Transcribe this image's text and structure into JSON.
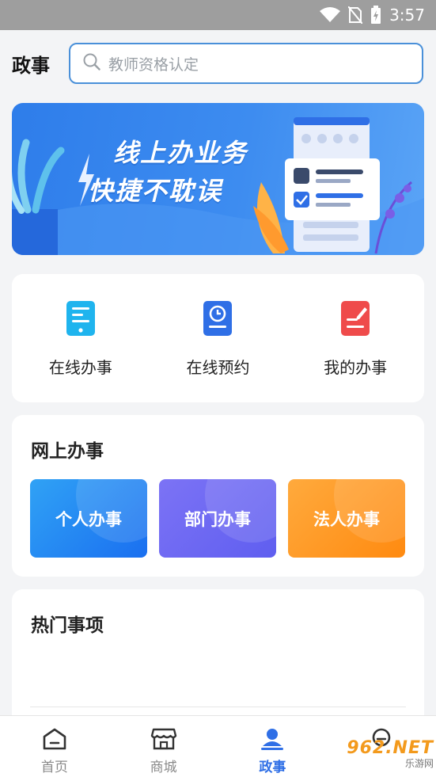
{
  "status_bar": {
    "time": "3:57"
  },
  "header": {
    "title": "政事",
    "search_placeholder": "教师资格认定"
  },
  "banner": {
    "line1": "线上办业务",
    "line2": "快捷不耽误"
  },
  "quick_services": [
    {
      "label": "在线办事",
      "icon": "phone-doc-icon",
      "color": "#1fb4ee"
    },
    {
      "label": "在线预约",
      "icon": "clock-doc-icon",
      "color": "#2f6fe6"
    },
    {
      "label": "我的办事",
      "icon": "edit-doc-icon",
      "color": "#ef4b4b"
    }
  ],
  "online_business": {
    "title": "网上办事",
    "tiles": [
      "个人办事",
      "部门办事",
      "法人办事"
    ]
  },
  "hot_items": {
    "title": "热门事项"
  },
  "bottom_nav": [
    {
      "label": "首页",
      "icon": "home-icon",
      "active": false
    },
    {
      "label": "商城",
      "icon": "store-icon",
      "active": false
    },
    {
      "label": "政事",
      "icon": "user-icon",
      "active": true
    },
    {
      "label": "",
      "icon": "profile-icon",
      "active": false
    }
  ],
  "watermark": {
    "brand": "962.NET",
    "sub": "乐游网"
  },
  "colors": {
    "accent": "#2f6fe6",
    "search_border": "#4a90d9"
  }
}
